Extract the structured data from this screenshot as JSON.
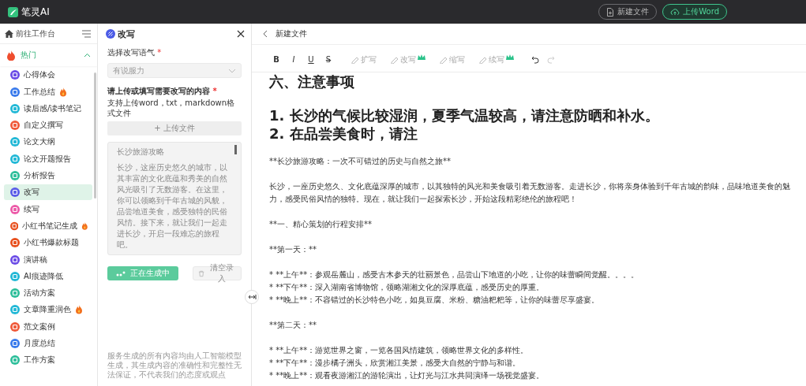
{
  "topbar": {
    "app_name": "笔灵AI",
    "buttons": [
      {
        "label": "新建文件",
        "kind": "outline"
      },
      {
        "label": "上传Word",
        "kind": "green"
      }
    ]
  },
  "sidebar": {
    "workbench": "前往工作台",
    "group": {
      "label": "热门",
      "expanded": true
    },
    "items": [
      {
        "label": "心得体会",
        "color": "#6c4de6",
        "hot": false,
        "selected": false
      },
      {
        "label": "工作总结",
        "color": "#3a7bec",
        "hot": true,
        "selected": false
      },
      {
        "label": "读后感/读书笔记",
        "color": "#22b8d6",
        "hot": false,
        "selected": false
      },
      {
        "label": "自定义撰写",
        "color": "#f05a3a",
        "hot": false,
        "selected": false
      },
      {
        "label": "论文大纲",
        "color": "#22b8d6",
        "hot": false,
        "selected": false
      },
      {
        "label": "论文开题报告",
        "color": "#22b8d6",
        "hot": false,
        "selected": false
      },
      {
        "label": "分析报告",
        "color": "#2fbf9b",
        "hot": false,
        "selected": false
      },
      {
        "label": "改写",
        "color": "#5a5ce8",
        "hot": false,
        "selected": true
      },
      {
        "label": "续写",
        "color": "#ec5aa8",
        "hot": false,
        "selected": false
      },
      {
        "label": "小红书笔记生成",
        "color": "#e8501e",
        "hot": true,
        "selected": false
      },
      {
        "label": "小红书爆款标题",
        "color": "#e8501e",
        "hot": false,
        "selected": false
      },
      {
        "label": "演讲稿",
        "color": "#6c4de6",
        "hot": false,
        "selected": false
      },
      {
        "label": "AI痕迹降低",
        "color": "#22b8d6",
        "hot": false,
        "selected": false
      },
      {
        "label": "活动方案",
        "color": "#2fbf9b",
        "hot": false,
        "selected": false
      },
      {
        "label": "文章降重润色",
        "color": "#22b8d6",
        "hot": true,
        "selected": false
      },
      {
        "label": "范文案例",
        "color": "#f05a3a",
        "hot": false,
        "selected": false
      },
      {
        "label": "月度总结",
        "color": "#3a7bec",
        "hot": false,
        "selected": false
      },
      {
        "label": "工作方案",
        "color": "#2fbf9b",
        "hot": false,
        "selected": false
      }
    ]
  },
  "panel": {
    "title": "改写",
    "tone_label": {
      "text": "选择改写语气",
      "required": "*"
    },
    "tone": {
      "placeholder": "有说服力"
    },
    "content_label": {
      "text": "请上传或填写需要改写的内容",
      "required": "*"
    },
    "content_hint": "支持上传word，txt，markdown格式文件",
    "upload_button": "+ 上传文件",
    "content_title": "长沙旅游攻略",
    "content_text": "长沙，这座历史悠久的城市，以其丰富的文化底蕴和秀美的自然风光吸引了无数游客。在这里，你可以领略到千年古城的风貌，品尝地道美食，感受独特的民俗风情。接下来，就让我们一起走进长沙，开启一段难忘的旅程吧。",
    "generate_button": {
      "label": "正在生成中",
      "loading": true
    },
    "clear_button": {
      "label": "清空录入",
      "disabled": true
    },
    "disclaimer": "服务生成的所有内容均由人工智能模型生成，其生成内容的准确性和完整性无法保证，不代表我们的态度或观点"
  },
  "editor": {
    "file_title": "新建文件",
    "format_buttons": [
      {
        "label": "B",
        "kind": "bold"
      },
      {
        "label": "I",
        "kind": "italic"
      },
      {
        "label": "U",
        "kind": "underline"
      },
      {
        "label": "S",
        "kind": "strike"
      }
    ],
    "tools": [
      {
        "label": "扩写",
        "premium": false
      },
      {
        "label": "改写",
        "premium": true
      },
      {
        "label": "缩写",
        "premium": false
      },
      {
        "label": "续写",
        "premium": true
      }
    ],
    "blocks": [
      {
        "kind": "heading",
        "lines": [
          "六、注意事项"
        ]
      },
      {
        "kind": "heading",
        "lines": [
          "1. 长沙的气候比较湿润，夏季气温较高，请注意防晒和补水。",
          "2. 在品尝美食时，请注"
        ]
      },
      {
        "kind": "text",
        "lines": [
          "**长沙旅游攻略：一次不可错过的历史与自然之旅**"
        ]
      },
      {
        "kind": "text",
        "lines": [
          "长沙，一座历史悠久、文化底蕴深厚的城市，以其独特的风光和美食吸引着无数游客。走进长沙，你将亲身体验到千年古城的韵味，品味地道美食的魅力，感受民俗风情的独特。现在，就让我们一起探索长沙，开始这段精彩绝伦的旅程吧！"
        ]
      },
      {
        "kind": "text",
        "lines": [
          "**一、精心策划的行程安排**"
        ]
      },
      {
        "kind": "text",
        "lines": [
          "**第一天：**"
        ]
      },
      {
        "kind": "text",
        "lines": [
          "* **上午**：参观岳麓山，感受古木参天的壮丽景色，品尝山下地道的小吃，让你的味蕾瞬间觉醒。。。。",
          "* **下午**：深入湖南省博物馆，领略湖湘文化的深厚底蕴，感受历史的厚重。",
          "* **晚上**：不容错过的长沙特色小吃，如臭豆腐、米粉、糖油粑粑等，让你的味蕾尽享盛宴。"
        ]
      },
      {
        "kind": "text",
        "lines": [
          "**第二天：**"
        ]
      },
      {
        "kind": "text",
        "lines": [
          "* **上午**：游览世界之窗，一览各国风情建筑，领略世界文化的多样性。",
          "* **下午**：漫步橘子洲头，欣赏湘江美景，感受大自然的宁静与和谐。",
          "* **晚上**：观看夜游湘江的游轮演出，让灯光与江水共同演绎一场视觉盛宴。"
        ]
      }
    ]
  }
}
